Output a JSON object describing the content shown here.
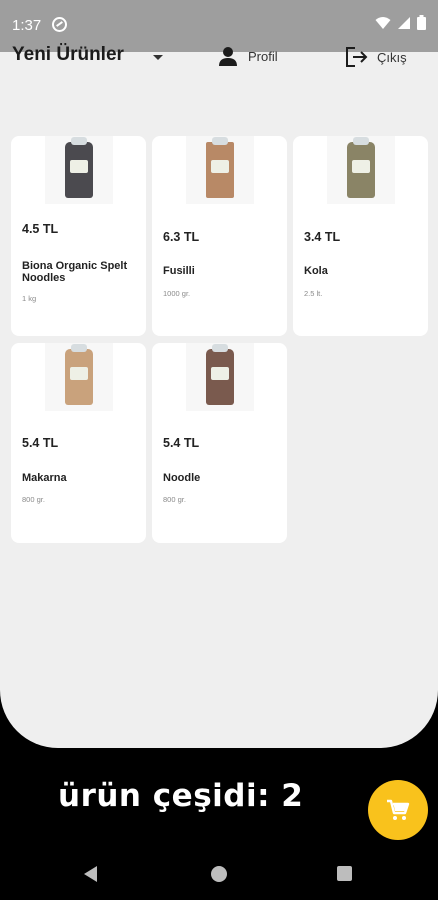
{
  "status_bar": {
    "time": "1:37",
    "icons": [
      "sync-icon",
      "wifi-icon",
      "signal-icon",
      "battery-icon"
    ]
  },
  "header": {
    "title": "Yeni Ürünler",
    "dropdown_icon": "chevron-down-icon",
    "profile_label": "Profil",
    "profile_icon": "person-icon",
    "logout_label": "Çıkış",
    "logout_icon": "logout-icon"
  },
  "products": [
    {
      "price": "4.5 TL",
      "name": "Biona Organic Spelt Noodles",
      "quantity": "1 kg",
      "image_color": "#4b4a4f"
    },
    {
      "price": "6.3 TL",
      "name": "Fusilli",
      "quantity": "1000 gr.",
      "image_color": "#b88966"
    },
    {
      "price": "3.4 TL",
      "name": "Kola",
      "quantity": "2.5 lt.",
      "image_color": "#8a8466"
    },
    {
      "price": "5.4 TL",
      "name": "Makarna",
      "quantity": "800 gr.",
      "image_color": "#c9a27c"
    },
    {
      "price": "5.4 TL",
      "name": "Noodle",
      "quantity": "800 gr.",
      "image_color": "#7a5a4e"
    }
  ],
  "footer": {
    "summary": "ürün çeşidi: 2",
    "cart_icon": "cart-icon",
    "fab_color": "#f9c21c"
  },
  "nav": {
    "back_icon": "back-icon",
    "home_icon": "home-icon",
    "recents_icon": "recents-icon"
  }
}
